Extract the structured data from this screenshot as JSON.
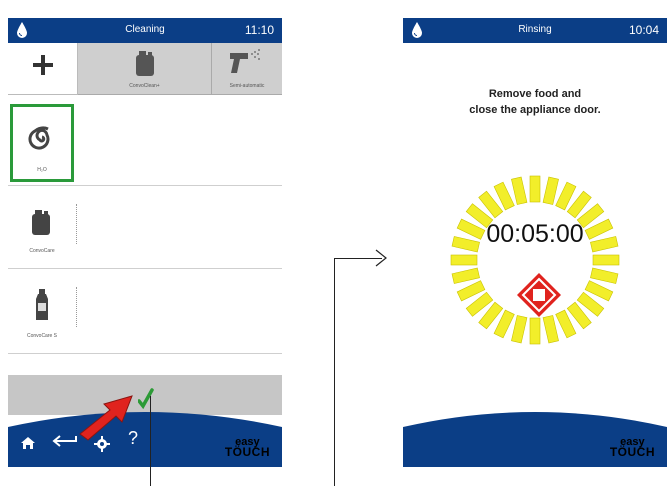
{
  "left_screen": {
    "title": "Cleaning",
    "time": "11:10",
    "toolbar": [
      {
        "icon": "plus-icon",
        "label": ""
      },
      {
        "icon": "canister-icon",
        "label": "ConvoClean+"
      },
      {
        "icon": "spray-gun-icon",
        "label": "Semi-automatic"
      }
    ],
    "programs": [
      {
        "icon": "spiral-icon",
        "label": "H₂O",
        "selected": true
      },
      {
        "icon": "canister-icon",
        "label": "ConvoCare"
      },
      {
        "icon": "bottle-icon",
        "label": "ConvoCare S"
      }
    ],
    "bottom_icons": [
      "home-icon",
      "back-arrow-icon",
      "gear-icon",
      "help-icon"
    ],
    "help_glyph": "?",
    "confirm_icon": "checkmark-icon",
    "brand_easy": "easy",
    "brand_touch": "TÖUCH"
  },
  "right_screen": {
    "title": "Rinsing",
    "time": "10:04",
    "message_line1": "Remove food and",
    "message_line2": "close the appliance door.",
    "timer": "00:05:00",
    "stop_icon": "stop-icon",
    "brand_easy": "easy",
    "brand_touch": "TÖUCH"
  },
  "colors": {
    "bar_blue": "#0b3e86",
    "select_green": "#2a9a3a",
    "dial_yellow": "#f2ee2a",
    "stop_red": "#e0231e",
    "check_green": "#2c9a36",
    "pointer_red": "#e0231e"
  }
}
